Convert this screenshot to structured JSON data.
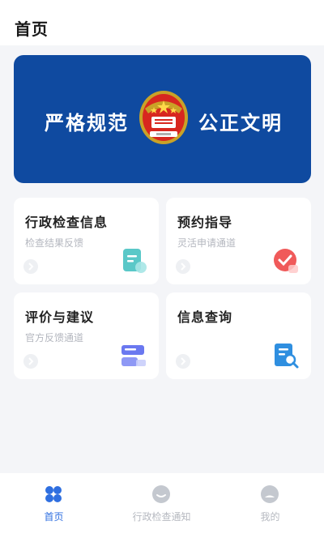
{
  "header": {
    "title": "首页"
  },
  "banner": {
    "left_text": "严格规范",
    "right_text": "公正文明",
    "emblem_icon": "police-emblem-icon"
  },
  "cards": [
    {
      "title": "行政检查信息",
      "subtitle": "检查结果反馈",
      "icon": "document-icon",
      "accent": "#5ac8c8"
    },
    {
      "title": "预约指导",
      "subtitle": "灵活申请通道",
      "icon": "check-badge-icon",
      "accent": "#f05a5a"
    },
    {
      "title": "评价与建议",
      "subtitle": "官方反馈通道",
      "icon": "feedback-icon",
      "accent": "#6a78f0"
    },
    {
      "title": "信息查询",
      "subtitle": "",
      "icon": "search-document-icon",
      "accent": "#2f8fe0"
    }
  ],
  "tabbar": {
    "items": [
      {
        "label": "首页",
        "icon": "home-grid-icon",
        "active": true
      },
      {
        "label": "行政检查通知",
        "icon": "message-icon",
        "active": false
      },
      {
        "label": "我的",
        "icon": "profile-icon",
        "active": false
      }
    ],
    "active_color": "#2f6fe0",
    "inactive_color": "#b6b9c0"
  }
}
